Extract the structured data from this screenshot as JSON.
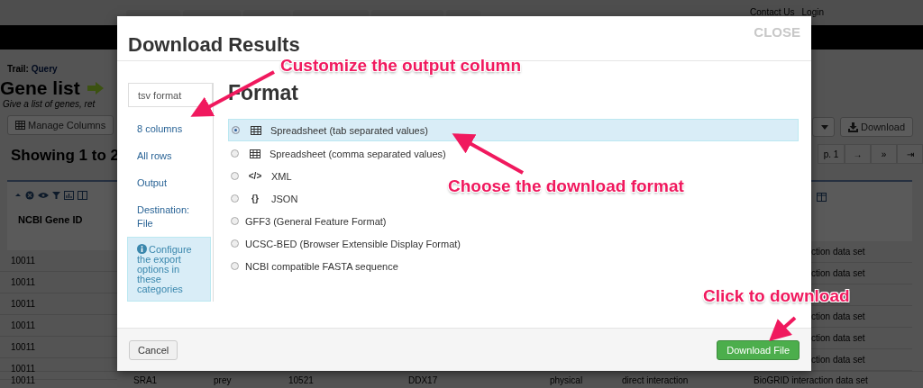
{
  "header": {
    "links": [
      "Contact Us",
      "Login"
    ]
  },
  "page": {
    "trail_label": "Trail:",
    "trail_link": "Query",
    "title": "Gene list",
    "subtitle": "Give a list of genes, ret",
    "manage_columns": "Manage Columns",
    "showing": "Showing 1 to 2",
    "download": "Download",
    "pager": [
      "p. 1",
      "→",
      "»",
      "⇥"
    ],
    "column_header": "NCBI Gene ID",
    "rows": [
      {
        "gene_id": "10011",
        "tail": "ction data set"
      },
      {
        "gene_id": "10011",
        "tail": "ction data set"
      },
      {
        "gene_id": "10011"
      },
      {
        "gene_id": "10011",
        "tail": "ction data set"
      },
      {
        "gene_id": "10011",
        "tail": "ction data set"
      },
      {
        "gene_id": "10011",
        "tail": "ction data set"
      }
    ],
    "last_row": [
      "10011",
      "SRA1",
      "prey",
      "10521",
      "DDX17",
      "physical",
      "direct interaction",
      "BioGRID interaction data set"
    ]
  },
  "dialog": {
    "title": "Download Results",
    "close": "CLOSE",
    "nav": [
      {
        "label": "tsv format",
        "selected": true
      },
      {
        "label": "8 columns",
        "selected": false
      },
      {
        "label": "All rows",
        "selected": false
      },
      {
        "label": "Output",
        "selected": false
      },
      {
        "label": "Destination: File",
        "selected": false
      }
    ],
    "info": "Configure the export options in these categories",
    "heading": "Format",
    "options": [
      {
        "kind": "table",
        "label": "Spreadsheet (tab separated values)",
        "selected": true
      },
      {
        "kind": "table",
        "label": "Spreadsheet (comma separated values)",
        "selected": false
      },
      {
        "kind": "glyph",
        "glyph": "</>",
        "label": "XML",
        "selected": false
      },
      {
        "kind": "glyph",
        "glyph": "{}",
        "label": "JSON",
        "selected": false
      },
      {
        "kind": "plain",
        "label": "GFF3 (General Feature Format)",
        "selected": false
      },
      {
        "kind": "plain",
        "label": "UCSC-BED (Browser Extensible Display Format)",
        "selected": false
      },
      {
        "kind": "plain",
        "label": "NCBI compatible FASTA sequence",
        "selected": false
      }
    ],
    "cancel": "Cancel",
    "submit": "Download File"
  },
  "annotations": [
    "Customize the output column",
    "Choose the download format",
    "Click to download"
  ]
}
